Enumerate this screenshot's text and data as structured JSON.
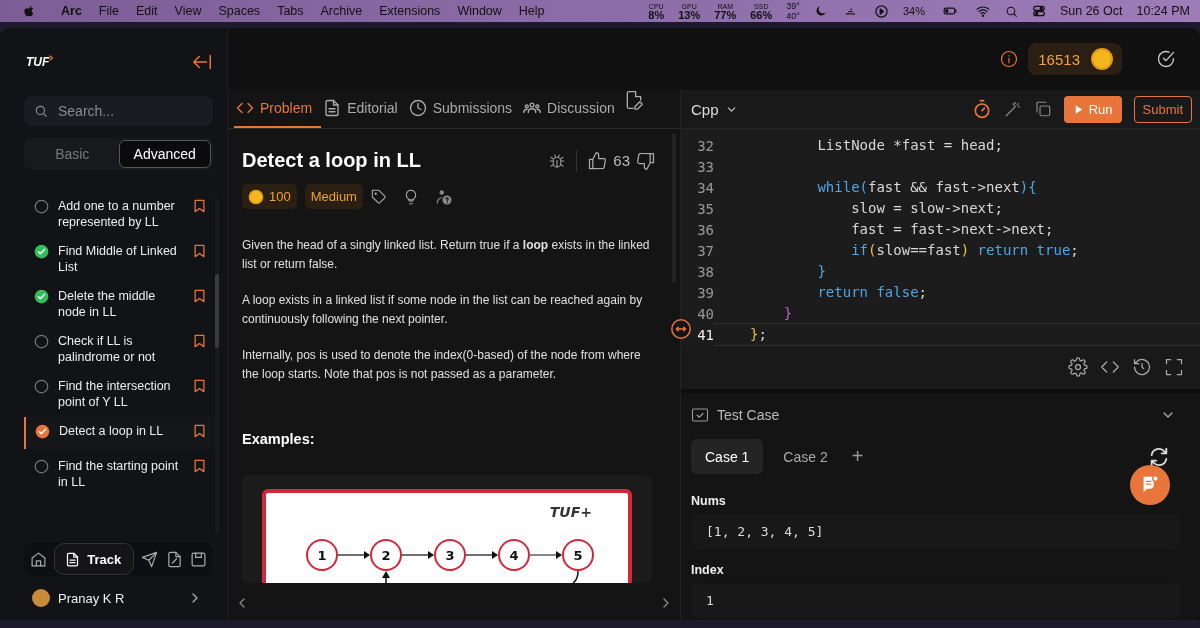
{
  "menu_bar": {
    "app": "Arc",
    "menus": [
      "File",
      "Edit",
      "View",
      "Spaces",
      "Tabs",
      "Archive",
      "Extensions",
      "Window",
      "Help"
    ],
    "stats": [
      {
        "label": "CPU",
        "value": "8%"
      },
      {
        "label": "GPU",
        "value": "13%"
      },
      {
        "label": "RAM",
        "value": "77%"
      },
      {
        "label": "SSD",
        "value": "66%"
      }
    ],
    "temps": [
      "39°",
      "40°"
    ],
    "battery": "34%",
    "date": "Sun 26 Oct",
    "time": "10:24 PM"
  },
  "sidebar": {
    "logo": "TUF",
    "search": {
      "placeholder": "Search..."
    },
    "modes": [
      {
        "label": "Basic",
        "selected": false
      },
      {
        "label": "Advanced",
        "selected": true
      }
    ],
    "problems": [
      {
        "title": "Add one to a number represented by LL",
        "solved": false,
        "selected": false
      },
      {
        "title": "Find Middle of Linked List",
        "solved": true,
        "selected": false
      },
      {
        "title": "Delete the middle node in LL",
        "solved": true,
        "selected": false
      },
      {
        "title": "Check if LL is palindrome or not",
        "solved": false,
        "selected": false
      },
      {
        "title": "Find the intersection point of Y LL",
        "solved": false,
        "selected": false
      },
      {
        "title": "Detect a loop in LL",
        "solved": true,
        "selected": true
      },
      {
        "title": "Find the starting point in LL",
        "solved": false,
        "selected": false
      }
    ],
    "track_button": "Track",
    "user": {
      "name": "Pranay K R"
    }
  },
  "header": {
    "coins": "16513"
  },
  "problem_tabs": [
    {
      "label": "Problem",
      "selected": true
    },
    {
      "label": "Editorial",
      "selected": false
    },
    {
      "label": "Submissions",
      "selected": false
    },
    {
      "label": "Discussion",
      "selected": false
    }
  ],
  "problem": {
    "title": "Detect a loop in LL",
    "likes": "63",
    "coins": "100",
    "difficulty": "Medium",
    "paragraphs": [
      "Given the head of a singly linked list. Return true if a **loop** exists in the linked list or return false.",
      "A loop exists in a linked list if some node in the list can be reached again by continuously following the next pointer.",
      "Internally, pos is used to denote the index(0-based) of the node from where the loop starts. Note that pos is not passed as a parameter."
    ],
    "examples_heading": "Examples:",
    "diagram": {
      "logo": "TUF+",
      "nodes": [
        "1",
        "2",
        "3",
        "4",
        "5"
      ]
    }
  },
  "editor": {
    "language": "Cpp",
    "run": "Run",
    "submit": "Submit",
    "lines": [
      {
        "number": "32",
        "current": false,
        "tokens": [
          {
            "text": "        ListNode *fast = head;",
            "kind": "plain"
          }
        ]
      },
      {
        "number": "33",
        "current": false
      },
      {
        "number": "34",
        "current": false,
        "tokens": [
          {
            "text": "        while(",
            "kind": "keyword"
          },
          {
            "text": "fast && fast->next",
            "kind": "plain"
          },
          {
            "text": "){",
            "kind": "keyword"
          }
        ]
      },
      {
        "number": "35",
        "current": false,
        "tokens": [
          {
            "text": "            slow = slow->next;",
            "kind": "plain"
          }
        ]
      },
      {
        "number": "36",
        "current": false,
        "tokens": [
          {
            "text": "            fast = fast->next->next;",
            "kind": "plain"
          }
        ]
      },
      {
        "number": "37",
        "current": false,
        "tokens": [
          {
            "text": "            if",
            "kind": "keyword"
          },
          {
            "text": "(",
            "kind": "bracket_yellow"
          },
          {
            "text": "slow==fast",
            "kind": "plain"
          },
          {
            "text": ")",
            "kind": "bracket_yellow"
          },
          {
            "text": " return true",
            "kind": "keyword"
          },
          {
            "text": ";",
            "kind": "plain"
          }
        ]
      },
      {
        "number": "38",
        "current": false,
        "tokens": [
          {
            "text": "        }",
            "kind": "keyword"
          }
        ]
      },
      {
        "number": "39",
        "current": false,
        "tokens": [
          {
            "text": "        return false",
            "kind": "keyword"
          },
          {
            "text": ";",
            "kind": "plain"
          }
        ]
      },
      {
        "number": "40",
        "current": false,
        "tokens": [
          {
            "text": "    }",
            "kind": "bracket_purple"
          }
        ]
      },
      {
        "number": "41",
        "current": true,
        "tokens": [
          {
            "text": "}",
            "kind": "bracket_yellow"
          },
          {
            "text": ";",
            "kind": "plain"
          }
        ]
      }
    ]
  },
  "test_cases": {
    "title": "Test Case",
    "cases": [
      {
        "label": "Case 1",
        "selected": true
      },
      {
        "label": "Case 2",
        "selected": false
      }
    ],
    "add_label": "+",
    "inputs": [
      {
        "label": "Nums",
        "value": "[1, 2, 3, 4, 5]"
      },
      {
        "label": "Index",
        "value": "1"
      }
    ]
  }
}
